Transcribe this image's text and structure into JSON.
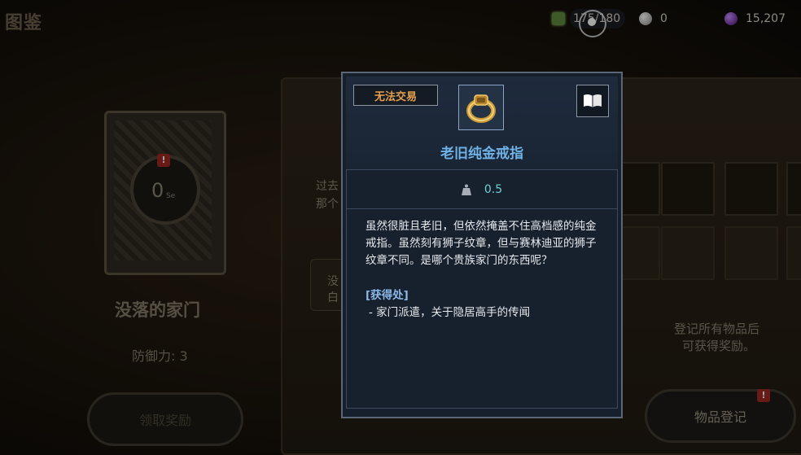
{
  "header": {
    "title": "图鉴"
  },
  "resources": {
    "stamina": {
      "value": "175/180",
      "icon": "stamina-icon"
    },
    "silver": {
      "value": "0",
      "icon": "silver-coin-icon"
    },
    "gem": {
      "value": "15,207",
      "icon": "purple-gem-icon"
    }
  },
  "collection": {
    "left_page_line1": "过去",
    "left_page_line2": "那个",
    "hidden_pill_line1": "没",
    "hidden_pill_line2": "白",
    "reward_hint_line1": "登记所有物品后",
    "reward_hint_line2": "可获得奖励。",
    "register_label": "物品登记",
    "register_badge": "!"
  },
  "set_card": {
    "count": "0",
    "unit": "Se",
    "badge": "!",
    "name": "没落的家门",
    "defense": "防御力: 3",
    "claim_label": "领取奖励"
  },
  "item_popup": {
    "trade_status": "无法交易",
    "item_icon": "gold-ring-icon",
    "codex_icon": "open-book-icon",
    "name": "老旧纯金戒指",
    "weight": "0.5",
    "description": "虽然很脏且老旧，但依然掩盖不住高档感的纯金戒指。虽然刻有狮子纹章，但与赛林迪亚的狮子纹章不同。是哪个贵族家门的东西呢？",
    "source_title": "[获得处]",
    "source_item": "- 家门派遣，关于隐居高手的传闻"
  },
  "colors": {
    "trade_text": "#e6a04a",
    "item_name": "#6fb2e8",
    "weight_value": "#6fcfcf",
    "source_title": "#8bb8e8",
    "alert_badge": "#a02a22"
  }
}
